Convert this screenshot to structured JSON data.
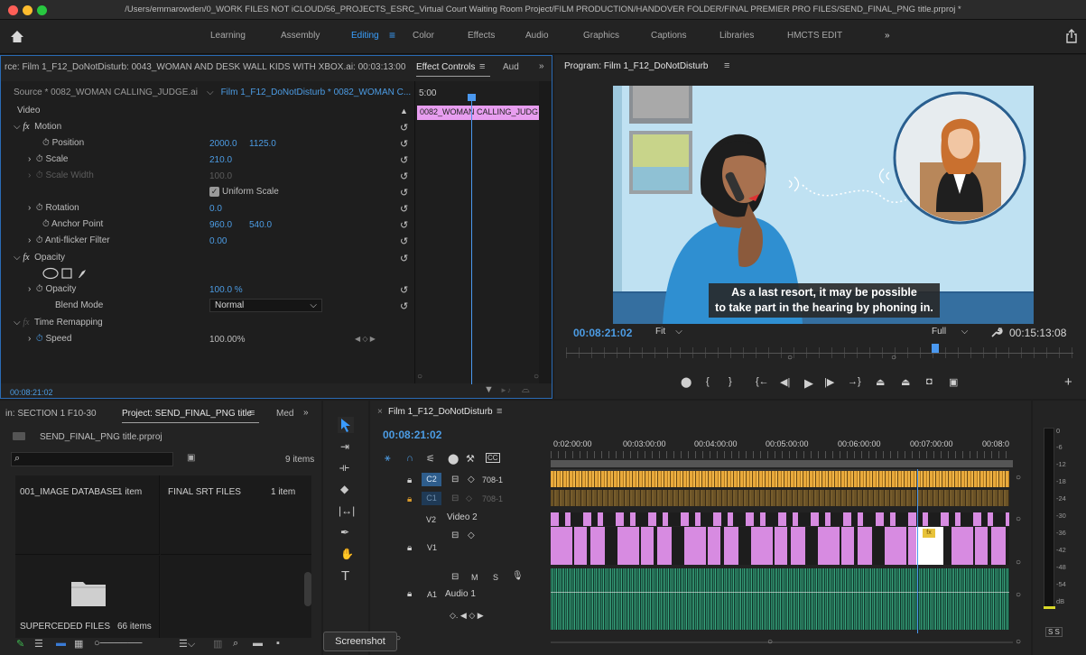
{
  "window": {
    "title": "/Users/emmarowden/0_WORK FILES NOT iCLOUD/56_PROJECTS_ESRC_Virtual Court Waiting Room Project/FILM PRODUCTION/HANDOVER FOLDER/FINAL PREMIER PRO FILES/SEND_FINAL_PNG title.prproj *"
  },
  "workspaces": {
    "items": [
      "Learning",
      "Assembly",
      "Editing",
      "Color",
      "Effects",
      "Audio",
      "Graphics",
      "Captions",
      "Libraries",
      "HMCTS EDIT"
    ],
    "active": "Editing",
    "more": "»"
  },
  "source_panel": {
    "header": "rce: Film 1_F12_DoNotDisturb: 0043_WOMAN AND DESK WALL KIDS WITH XBOX.ai: 00:03:13:00",
    "tab_effect": "Effect Controls",
    "tab_audio": "Aud",
    "more": "»"
  },
  "effect_controls": {
    "source_item": "Source * 0082_WOMAN CALLING_JUDGE.ai",
    "seq_item": "Film 1_F12_DoNotDisturb * 0082_WOMAN C...",
    "timecode_start": "5:00",
    "clip_label": "0082_WOMAN CALLING_JUDG",
    "video_label": "Video",
    "motion": "Motion",
    "position_label": "Position",
    "position_x": "2000.0",
    "position_y": "1125.0",
    "scale_label": "Scale",
    "scale": "210.0",
    "scale_width_label": "Scale Width",
    "scale_width": "100.0",
    "uniform_label": "Uniform Scale",
    "rotation_label": "Rotation",
    "rotation": "0.0",
    "anchor_label": "Anchor Point",
    "anchor_x": "960.0",
    "anchor_y": "540.0",
    "antiflicker_label": "Anti-flicker Filter",
    "antiflicker": "0.00",
    "opacity_section": "Opacity",
    "opacity_label": "Opacity",
    "opacity": "100.0 %",
    "blend_label": "Blend Mode",
    "blend_value": "Normal",
    "time_remap": "Time Remapping",
    "speed_label": "Speed",
    "speed": "100.00%",
    "footer_time": "00:08:21:02"
  },
  "program_panel": {
    "title": "Program: Film 1_F12_DoNotDisturb",
    "caption_line1": "As a last resort, it may be possible",
    "caption_line2": "to take part in the hearing by phoning in.",
    "timecode": "00:08:21:02",
    "fit": "Fit",
    "quality": "Full",
    "duration": "00:15:13:08"
  },
  "project_panel": {
    "tab_bin": "in: SECTION 1 F10-30",
    "tab_project": "Project: SEND_FINAL_PNG title",
    "tab_media": "Med",
    "more": "»",
    "file_name": "SEND_FINAL_PNG title.prproj",
    "item_count": "9 items",
    "bins": [
      {
        "name": "001_IMAGE DATABASE",
        "count": "1 item"
      },
      {
        "name": "FINAL SRT FILES",
        "count": "1 item"
      },
      {
        "name": "SUPERCEDED FILES",
        "count": "66 items"
      }
    ]
  },
  "timeline": {
    "title": "Film 1_F12_DoNotDisturb",
    "timecode": "00:08:21:02",
    "ruler": [
      "0:02:00:00",
      "00:03:00:00",
      "00:04:00:00",
      "00:05:00:00",
      "00:06:00:00",
      "00:07:00:00",
      "00:08:0"
    ],
    "tracks": {
      "c2": "C2",
      "c1": "C1",
      "c2_name": "708-1",
      "c1_name": "708-1",
      "v2": "V2",
      "v2_name": "Video 2",
      "v1": "V1",
      "a1": "A1",
      "a1_name": "Audio 1",
      "m": "M",
      "s": "S"
    }
  },
  "meter": {
    "scale": [
      "0",
      "-6",
      "-12",
      "-18",
      "-24",
      "-30",
      "-36",
      "-42",
      "-48",
      "-54",
      "dB"
    ],
    "s_labels": "S S"
  },
  "tooltip": "Screenshot",
  "colors": {
    "accent": "#3aa0ff",
    "clip_pink": "#d78be1",
    "caption_yellow": "#e8a93b",
    "audio_green": "#2c8a6a",
    "playhead": "#4a98ef",
    "sky": "#bfe1f2"
  }
}
